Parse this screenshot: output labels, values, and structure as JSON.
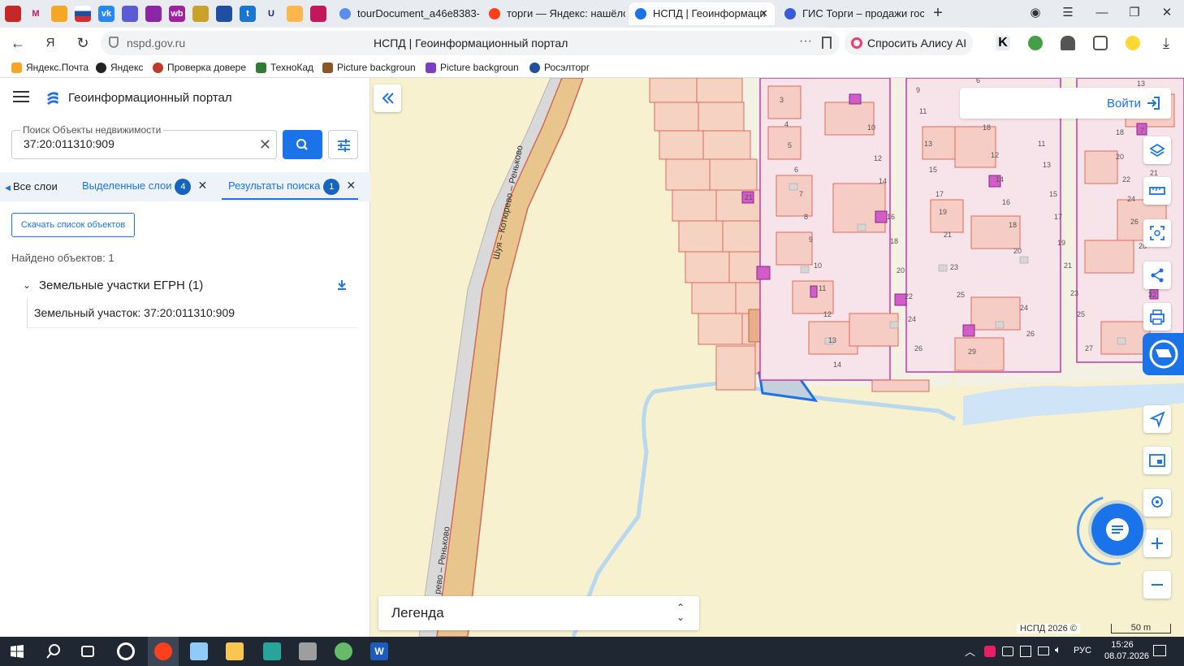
{
  "browser": {
    "tabs": [
      {
        "label": "tourDocument_a46e8383-",
        "icon": "document-icon",
        "color": "#5b8def"
      },
      {
        "label": "торги — Яндекс: нашёлся",
        "icon": "yandex-icon",
        "color": "#fc3f1d"
      },
      {
        "label": "НСПД | Геоинформаци",
        "icon": "nspd-icon",
        "color": "#1a73e8",
        "active": true
      },
      {
        "label": "ГИС Торги – продажи гос",
        "icon": "gis-torgi-icon",
        "color": "#3a5bd9"
      }
    ],
    "url": "nspd.gov.ru",
    "page_title": "НСПД | Геоинформационный портал",
    "alice_button": "Спросить Алису AI",
    "bookmarks": [
      {
        "label": "Яндекс.Почта",
        "color": "#f5a623"
      },
      {
        "label": "Яндекс",
        "color": "#222222"
      },
      {
        "label": "Проверка доверe",
        "color": "#c0392b"
      },
      {
        "label": "ТехноКад",
        "color": "#2e7d32"
      },
      {
        "label": "Picture backgroun",
        "color": "#8d5524"
      },
      {
        "label": "Picture backgroun",
        "color": "#7b3fbf"
      },
      {
        "label": "Росэлторг",
        "color": "#1e4fa0"
      }
    ]
  },
  "sidebar": {
    "title": "Геоинформационный портал",
    "search": {
      "label": "Поиск Объекты недвижимости",
      "value": "37:20:011310:909"
    },
    "tabs": [
      {
        "label": "Все слои"
      },
      {
        "label": "Выделенные слои",
        "badge": "4"
      },
      {
        "label": "Результаты поиска",
        "badge": "1",
        "active": true
      }
    ],
    "download_label": "Скачать список объектов",
    "found_label": "Найдено объектов: 1",
    "group_label": "Земельные участки ЕГРН (1)",
    "result_label": "Земельный участок: 37:20:011310:909"
  },
  "map": {
    "login_label": "Войти",
    "legend_label": "Легенда",
    "copyright": "НСПД 2026 ©",
    "scale_label": "50 m",
    "road_label_1": "Шуя – Котюрево – Реньково",
    "road_label_2": "рево – Реньково",
    "plot_numbers": [
      "21",
      "3",
      "4",
      "5",
      "6",
      "7",
      "8",
      "9",
      "10",
      "11",
      "12",
      "13",
      "14",
      "10",
      "12",
      "14",
      "16",
      "18",
      "20",
      "22",
      "24",
      "26",
      "28",
      "9",
      "11",
      "13",
      "15",
      "17",
      "19",
      "21",
      "23",
      "25",
      "27",
      "29",
      "6",
      "10",
      "12",
      "14",
      "16",
      "18",
      "20",
      "22",
      "24",
      "26",
      "13",
      "11",
      "13",
      "15",
      "17",
      "19",
      "21",
      "23",
      "25",
      "27",
      "18",
      "20",
      "22",
      "24",
      "26",
      "28",
      "7",
      "32",
      "13",
      "21"
    ],
    "colors": {
      "map_bg": "#f7f1cf",
      "parcel_fill": "#f6d2c3",
      "parcel_stroke": "#e06a5a",
      "building": "#d25cc8",
      "selected_stroke": "#1a73e8",
      "water": "#cfe4f7",
      "accent": "#1a73e8"
    }
  },
  "taskbar": {
    "lang": "РУС",
    "time": "15:26",
    "date": "08.07.2026"
  }
}
